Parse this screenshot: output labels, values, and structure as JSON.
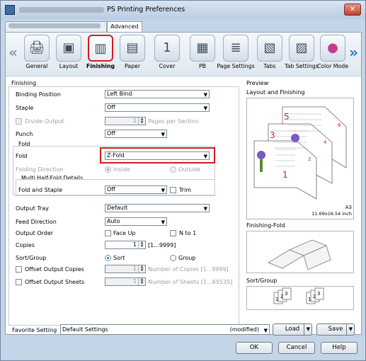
{
  "window": {
    "title": "PS Printing Preferences",
    "close_glyph": "✕"
  },
  "tabs": {
    "advanced": "Advanced"
  },
  "toolbar": {
    "items": [
      {
        "label": "General",
        "icon": "🖨"
      },
      {
        "label": "Layout",
        "icon": "▣"
      },
      {
        "label": "Finishing",
        "icon": "▥"
      },
      {
        "label": "Paper",
        "icon": "▤"
      },
      {
        "label": "Cover",
        "icon": "1"
      },
      {
        "label": "PB",
        "icon": "▦"
      },
      {
        "label": "Page Settings",
        "icon": "≣"
      },
      {
        "label": "Tabs",
        "icon": "▧"
      },
      {
        "label": "Tab Settings",
        "icon": "▨"
      },
      {
        "label": "Color Mode",
        "icon": "●"
      }
    ],
    "nav_left": "«",
    "nav_right": "»"
  },
  "finishing": {
    "section": "Finishing",
    "binding_position": {
      "label": "Binding Position",
      "value": "Left Bind"
    },
    "staple": {
      "label": "Staple",
      "value": "Off"
    },
    "divide_output": {
      "label": "Divide Output",
      "value": "1",
      "suffix": "Pages per Section"
    },
    "punch": {
      "label": "Punch",
      "value": "Off"
    },
    "fold_group": "Fold",
    "fold": {
      "label": "Fold",
      "value": "Z-Fold"
    },
    "folding_direction": {
      "label": "Folding Direction",
      "inside": "Inside",
      "outside": "Outside"
    },
    "multi_half_fold": "Multi Half-Fold Details",
    "fold_and_staple": {
      "label": "Fold and Staple",
      "value": "Off",
      "trim": "Trim"
    },
    "output_tray": {
      "label": "Output Tray",
      "value": "Default"
    },
    "feed_direction": {
      "label": "Feed Direction",
      "value": "Auto"
    },
    "output_order": {
      "label": "Output Order",
      "face_up": "Face Up",
      "n_to_1": "N to 1"
    },
    "copies": {
      "label": "Copies",
      "value": "1",
      "range": "[1...9999]"
    },
    "sort_group": {
      "label": "Sort/Group",
      "sort": "Sort",
      "group": "Group"
    },
    "offset_copies": {
      "label": "Offset Output Copies",
      "value": "1",
      "suffix": "Number of Copies [1...9999]"
    },
    "offset_sheets": {
      "label": "Offset Output Sheets",
      "value": "1",
      "suffix": "Number of Sheets [1...65535]"
    }
  },
  "preview": {
    "section": "Preview",
    "layout_title": "Layout and Finishing",
    "page_numbers": [
      "5",
      "3",
      "1",
      "6",
      "4",
      "2"
    ],
    "paper_size": "A3",
    "paper_dims": "11.69x16.54 inch",
    "finishing_fold": "Finishing-Fold",
    "sort_group": "Sort/Group"
  },
  "favorite": {
    "label": "Favorite Setting",
    "value": "Default Settings",
    "status": "(modified)",
    "load": "Load",
    "save": "Save"
  },
  "buttons": {
    "ok": "OK",
    "cancel": "Cancel",
    "help": "Help"
  },
  "colors": {
    "highlight": "#d71920",
    "accent": "#2f77c4"
  }
}
